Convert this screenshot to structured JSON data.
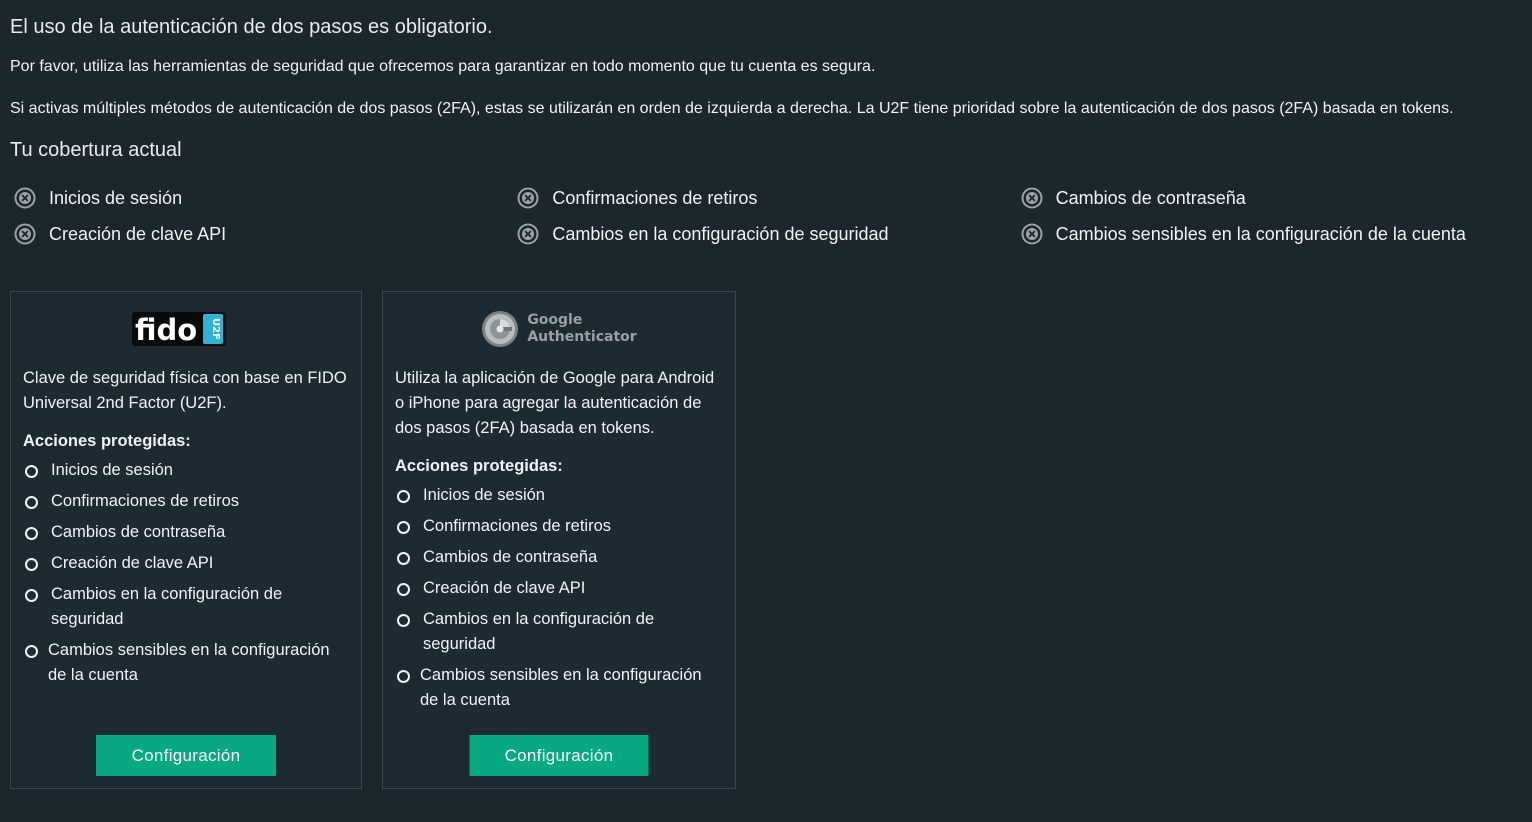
{
  "header": {
    "title": "El uso de la autenticación de dos pasos es obligatorio.",
    "paragraph1": "Por favor, utiliza las herramientas de seguridad que ofrecemos para garantizar en todo momento que tu cuenta es segura.",
    "paragraph2": "Si activas múltiples métodos de autenticación de dos pasos (2FA), estas se utilizarán en orden de izquierda a derecha. La U2F tiene prioridad sobre la autenticación de dos pasos (2FA) basada en tokens."
  },
  "coverage": {
    "title": "Tu cobertura actual",
    "items": [
      "Inicios de sesión",
      "Confirmaciones de retiros",
      "Cambios de contraseña",
      "Creación de clave API",
      "Cambios en la configuración de seguridad",
      "Cambios sensibles en la configuración de la cuenta"
    ],
    "icon": "x-circle-icon",
    "icon_color": "#9aa3a8"
  },
  "cards": [
    {
      "logo": "fido-u2f-logo",
      "logo_text": "fido",
      "logo_badge": "U2F",
      "description": "Clave de seguridad física con base en FIDO Universal 2nd Factor (U2F).",
      "protected_label": "Acciones protegidas:",
      "actions": [
        "Inicios de sesión",
        "Confirmaciones de retiros",
        "Cambios de contraseña",
        "Creación de clave API",
        "Cambios en la configuración de seguridad",
        "Cambios sensibles en la configuración de la cuenta"
      ],
      "button": "Configuración"
    },
    {
      "logo": "google-authenticator-logo",
      "logo_line1": "Google",
      "logo_line2": "Authenticator",
      "description": "Utiliza la aplicación de Google para Android o iPhone para agregar la autenticación de dos pasos (2FA) basada en tokens.",
      "protected_label": "Acciones protegidas:",
      "actions": [
        "Inicios de sesión",
        "Confirmaciones de retiros",
        "Cambios de contraseña",
        "Creación de clave API",
        "Cambios en la configuración de seguridad",
        "Cambios sensibles en la configuración de la cuenta"
      ],
      "button": "Configuración"
    }
  ],
  "colors": {
    "background": "#1c262d",
    "accent": "#07a882",
    "card_border": "#3a464e"
  }
}
